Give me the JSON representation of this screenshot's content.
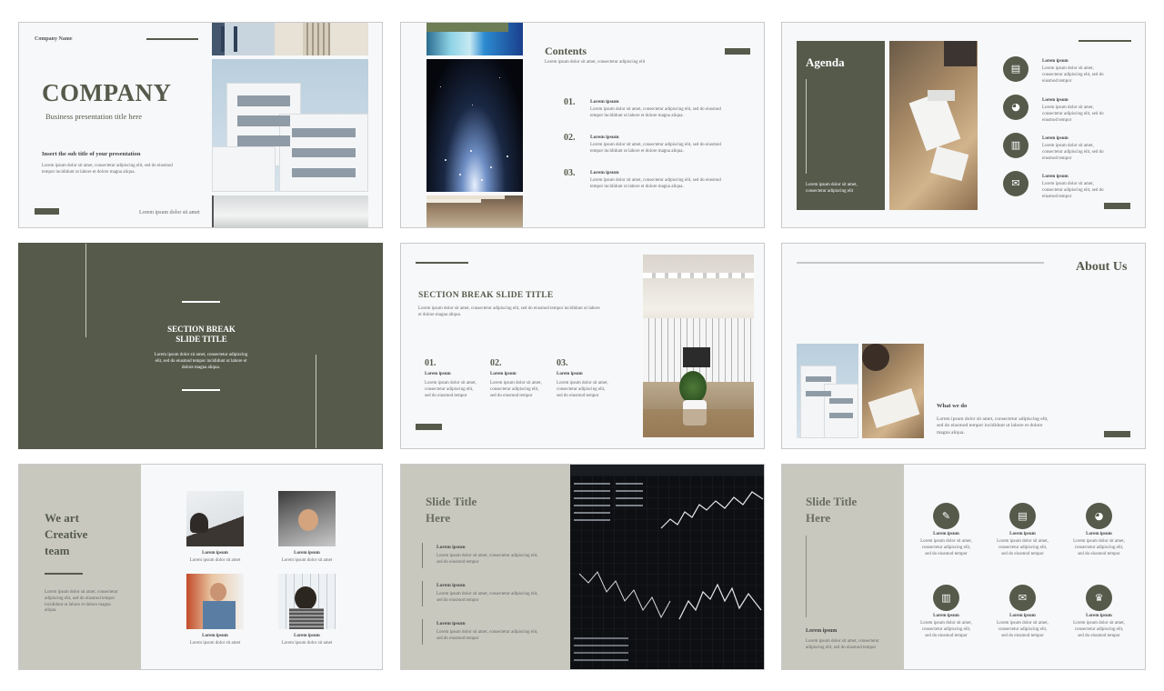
{
  "colors": {
    "accent": "#555a4b",
    "panel_gray": "#c8c8bf",
    "background": "#f7f8f9"
  },
  "slide1": {
    "company_name": "Company Name",
    "title": "COMPANY",
    "subtitle": "Business presentation title here",
    "subtitle2": "Insert the sub title of your presentation",
    "body": "Lorem ipsum dolor sit amet, consectetur adipiscing elit, sed do eiusmod tempor incididunt ut labore et dolore magna aliqua.",
    "footer": "Lorem ipsum dolor sit amet"
  },
  "slide2": {
    "title": "Contents",
    "subtitle": "Lorem ipsum dolor sit amet, consectetur adipiscing elit",
    "items": [
      {
        "num": "01.",
        "title": "Lorem ipsum",
        "text": "Lorem ipsum dolor sit amet, consectetur adipiscing elit, sed do eiusmod tempor incididunt ut labore et dolore magna aliqua."
      },
      {
        "num": "02.",
        "title": "Lorem ipsum",
        "text": "Lorem ipsum dolor sit amet, consectetur adipiscing elit, sed do eiusmod tempor incididunt ut labore et dolore magna aliqua."
      },
      {
        "num": "03.",
        "title": "Lorem ipsum",
        "text": "Lorem ipsum dolor sit amet, consectetur adipiscing elit, sed do eiusmod tempor incididunt ut labore et dolore magna aliqua."
      }
    ]
  },
  "slide3": {
    "title": "Agenda",
    "panel_text": "Lorem ipsum dolor sit amet, consectetur adipiscing elit",
    "items": [
      {
        "icon": "clipboard-icon",
        "title": "Lorem ipsum",
        "text": "Lorem ipsum dolor sit amet, consectetur adipiscing elit, sed do eiusmod tempor"
      },
      {
        "icon": "pie-chart-icon",
        "title": "Lorem ipsum",
        "text": "Lorem ipsum dolor sit amet, consectetur adipiscing elit, sed do eiusmod tempor"
      },
      {
        "icon": "bar-chart-icon",
        "title": "Lorem ipsum",
        "text": "Lorem ipsum dolor sit amet, consectetur adipiscing elit, sed do eiusmod tempor"
      },
      {
        "icon": "chat-icon",
        "title": "Lorem ipsum",
        "text": "Lorem ipsum dolor sit amet, consectetur adipiscing elit, sed do eiusmod tempor"
      }
    ]
  },
  "slide4": {
    "title_line1": "SECTION BREAK",
    "title_line2": "SLIDE TITLE",
    "text": "Lorem ipsum dolor sit amet, consectetur adipiscing elit, sed do eiusmod tempor incididunt ut labore et dolore magna aliqua."
  },
  "slide5": {
    "title": "SECTION BREAK SLIDE TITLE",
    "text": "Lorem ipsum dolor sit amet, consectetur adipiscing elit, sed do eiusmod tempor incididunt ut labore et dolore magna aliqua.",
    "items": [
      {
        "num": "01.",
        "title": "Lorem ipsum",
        "text": "Lorem ipsum dolor sit amet, consectetur adipiscing elit, sed do eiusmod tempor"
      },
      {
        "num": "02.",
        "title": "Lorem ipsum",
        "text": "Lorem ipsum dolor sit amet, consectetur adipiscing elit, sed do eiusmod tempor"
      },
      {
        "num": "03.",
        "title": "Lorem ipsum",
        "text": "Lorem ipsum dolor sit amet, consectetur adipiscing elit, sed do eiusmod tempor"
      }
    ]
  },
  "slide6": {
    "title": "About Us",
    "heading": "What we do",
    "text": "Lorem ipsum dolor sit amet, consectetur adipiscing elit, sed do eiusmod tempor incididunt ut labore et dolore magna aliqua."
  },
  "slide7": {
    "title_line1": "We art",
    "title_line2": "Creative",
    "title_line3": "team",
    "text": "Lorem ipsum dolor sit amet, consectetur adipiscing elit, sed do eiusmod tempor incididunt ut labore et dolore magna aliqua.",
    "members": [
      {
        "name": "Lorem ipsum",
        "role": "Lorem ipsum dolor sit amet"
      },
      {
        "name": "Lorem ipsum",
        "role": "Lorem ipsum dolor sit amet"
      },
      {
        "name": "Lorem ipsum",
        "role": "Lorem ipsum dolor sit amet"
      },
      {
        "name": "Lorem ipsum",
        "role": "Lorem ipsum dolor sit amet"
      }
    ]
  },
  "slide8": {
    "title_line1": "Slide Title",
    "title_line2": "Here",
    "items": [
      {
        "title": "Lorem ipsum",
        "text": "Lorem ipsum dolor sit amet, consectetur adipiscing elit, sed do eiusmod tempor"
      },
      {
        "title": "Lorem ipsum",
        "text": "Lorem ipsum dolor sit amet, consectetur adipiscing elit, sed do eiusmod tempor"
      },
      {
        "title": "Lorem ipsum",
        "text": "Lorem ipsum dolor sit amet, consectetur adipiscing elit, sed do eiusmod tempor"
      }
    ]
  },
  "slide9": {
    "title_line1": "Slide Title",
    "title_line2": "Here",
    "panel_title": "Lorem ipsum",
    "panel_text": "Lorem ipsum dolor sit amet, consectetur adipiscing elit, sed do eiusmod tempor",
    "items": [
      {
        "icon": "document-icon",
        "title": "Lorem ipsum",
        "text": "Lorem ipsum dolor sit amet, consectetur adipiscing elit, sed do eiusmod tempor"
      },
      {
        "icon": "clipboard-icon",
        "title": "Lorem ipsum",
        "text": "Lorem ipsum dolor sit amet, consectetur adipiscing elit, sed do eiusmod tempor"
      },
      {
        "icon": "pie-chart-icon",
        "title": "Lorem ipsum",
        "text": "Lorem ipsum dolor sit amet, consectetur adipiscing elit, sed do eiusmod tempor"
      },
      {
        "icon": "bar-chart-icon",
        "title": "Lorem ipsum",
        "text": "Lorem ipsum dolor sit amet, consectetur adipiscing elit, sed do eiusmod tempor"
      },
      {
        "icon": "chat-icon",
        "title": "Lorem ipsum",
        "text": "Lorem ipsum dolor sit amet, consectetur adipiscing elit, sed do eiusmod tempor"
      },
      {
        "icon": "trophy-icon",
        "title": "Lorem ipsum",
        "text": "Lorem ipsum dolor sit amet, consectetur adipiscing elit, sed do eiusmod tempor"
      }
    ]
  }
}
